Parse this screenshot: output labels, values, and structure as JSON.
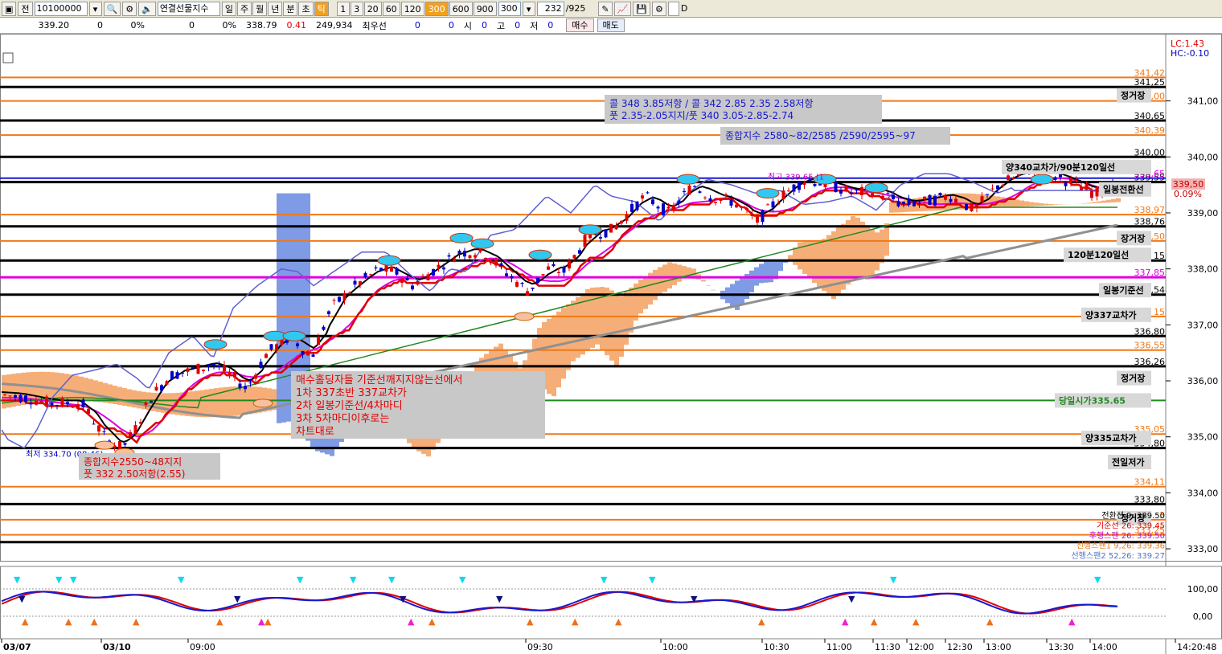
{
  "toolbar": {
    "code": "10100000",
    "name": "연결선물지수",
    "periods": [
      "일",
      "주",
      "월",
      "년",
      "분",
      "초",
      "틱"
    ],
    "active_period": "틱",
    "intervals": [
      "1",
      "3",
      "20",
      "60",
      "120",
      "300",
      "600",
      "900"
    ],
    "active_interval": "300",
    "interval_value": "300",
    "count": "232",
    "count_total": "/925",
    "check_label": "D"
  },
  "quote": {
    "price1": "339.20",
    "v1": "0",
    "p1": "0%",
    "v2": "0",
    "p2": "0%",
    "price2": "338.79",
    "chg": "0.41",
    "volume": "249,934",
    "best_label": "최우선",
    "best_bid": "0",
    "best_ask": "0",
    "open_label": "시",
    "open": "0",
    "high_label": "고",
    "high": "0",
    "low_label": "저",
    "low": "0",
    "buy_label": "매수",
    "sell_label": "매도"
  },
  "colors": {
    "up": "#e00000",
    "down": "#0000c8",
    "orange": "#f07818",
    "black": "#000000",
    "magenta": "#e000e0",
    "blue": "#1818d0",
    "green": "#208820",
    "cloud_up": "#f4a060",
    "cloud_down": "#6a8ae0",
    "gray": "#909090"
  },
  "chart_data": {
    "type": "candlestick",
    "ylim": [
      332.8,
      342.2
    ],
    "right_axis_labels": [
      "341,00",
      "340,00",
      "339,00",
      "338,00",
      "337,00",
      "336,00",
      "335,00",
      "334,00",
      "333,00"
    ],
    "x_labels": [
      "03/07",
      "03/10",
      "09:00",
      "09:30",
      "10:00",
      "10:30",
      "11:00",
      "11:30",
      "12:00",
      "12:30",
      "13:00",
      "13:30",
      "14:00",
      "14:20:48"
    ],
    "orange_levels": [
      {
        "value": 341.42,
        "label": "341,42"
      },
      {
        "value": 341.0,
        "label": "341,00"
      },
      {
        "value": 340.39,
        "label": "340,39"
      },
      {
        "value": 338.97,
        "label": "338,97"
      },
      {
        "value": 338.5,
        "label": "8,50"
      },
      {
        "value": 337.15,
        "label": "15"
      },
      {
        "value": 336.55,
        "label": "336,55"
      },
      {
        "value": 335.05,
        "label": "335,05"
      },
      {
        "value": 334.11,
        "label": "334,11"
      },
      {
        "value": 333.52,
        "label": "3"
      },
      {
        "value": 333.25,
        "label": "333,25"
      }
    ],
    "black_levels": [
      {
        "value": 341.25,
        "label": "341,25"
      },
      {
        "value": 340.65,
        "label": "340,65"
      },
      {
        "value": 340.0,
        "label": "340,00"
      },
      {
        "value": 339.55,
        "label": "339,55"
      },
      {
        "value": 338.76,
        "label": "338,76"
      },
      {
        "value": 338.15,
        "label": "15"
      },
      {
        "value": 337.54,
        "label": "7,54"
      },
      {
        "value": 336.8,
        "label": "336,80"
      },
      {
        "value": 336.26,
        "label": "336,26"
      },
      {
        "value": 334.8,
        "label": "334,80"
      },
      {
        "value": 333.8,
        "label": "333,80"
      },
      {
        "value": 333.12,
        "label": ""
      }
    ],
    "blue_level": {
      "value": 339.62,
      "label": "339,65"
    },
    "magenta_level": {
      "value": 337.85,
      "label": "337,85"
    },
    "green_level": {
      "value": 335.65,
      "label": "당일시가335.65"
    },
    "current_price": {
      "value": 339.5,
      "label": "339,50",
      "pct": "0.09%"
    },
    "lc_hc": [
      "LC:1.43",
      "HC:-0.10"
    ],
    "level_tags": [
      {
        "value": 341.1,
        "text": "정거장"
      },
      {
        "value": 339.82,
        "text": "양340교차가/90분120일선"
      },
      {
        "value": 339.42,
        "text": "일봉전환선"
      },
      {
        "value": 338.55,
        "text": "장거장"
      },
      {
        "value": 338.25,
        "text": "120분120일선"
      },
      {
        "value": 337.62,
        "text": "일봉기준선"
      },
      {
        "value": 337.18,
        "text": "양337교차가"
      },
      {
        "value": 336.05,
        "text": "정거장"
      },
      {
        "value": 335.65,
        "text": "당일시가335.65"
      },
      {
        "value": 334.98,
        "text": "양335교차가"
      },
      {
        "value": 334.55,
        "text": "전일저가"
      },
      {
        "value": 333.55,
        "text": "정거장"
      }
    ],
    "high_marker": {
      "text": "최고 339.65 (1",
      "value": 339.65
    },
    "low_marker": {
      "text": "최저 334.70 (08:46)",
      "value": 334.7
    },
    "indicator_legend": [
      {
        "text": "전환선 9: 339.50",
        "color": "#000000"
      },
      {
        "text": "기준선 26: 339.45",
        "color": "#e00000"
      },
      {
        "text": "후행스팬 26: 339.50",
        "color": "#c000c0"
      },
      {
        "text": "선행스팬1 9,26: 339.36",
        "color": "#f07818"
      },
      {
        "text": "선행스팬2 52,26: 339.27",
        "color": "#5070c0"
      }
    ],
    "annotations": {
      "call_put": [
        "콜 348 3.85저항 / 콜 342 2.85 2.35 2.58저항",
        "풋 2.35-2.05지지/풋 340 3.05-2.85-2.74"
      ],
      "index_levels": "종합지수 2580~82/2585 /2590/2595~97",
      "holding": [
        "매수홀딩자들 기준선깨지지않는선에서",
        "1차 337초반 337교차가",
        "2차 일봉기준선/4차마디",
        "3차 5차마디이후로는",
        "차트대로"
      ],
      "index_support": [
        "종합지수2550~48지지",
        "풋 332 2.50저항(2.55)"
      ]
    },
    "oscillator": {
      "levels": [
        "100,00",
        "0,00"
      ]
    }
  }
}
